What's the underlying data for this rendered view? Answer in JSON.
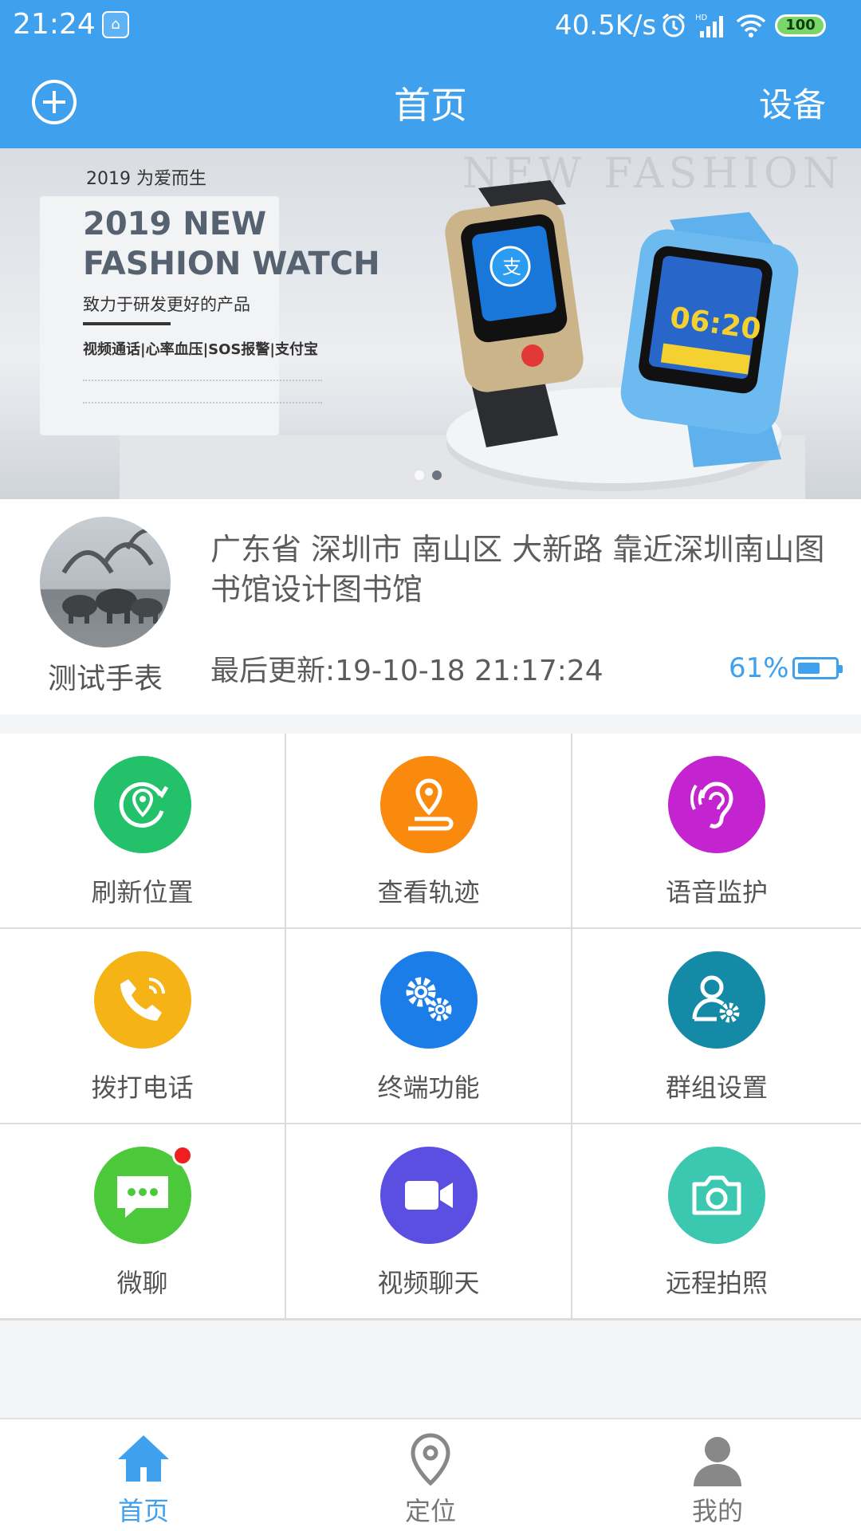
{
  "status_bar": {
    "time": "21:24",
    "net_speed": "40.5K/s",
    "battery_level": "100"
  },
  "header": {
    "title": "首页",
    "right_action": "设备"
  },
  "banner": {
    "year_line": "2019 为爱而生",
    "headline_1": "2019 NEW",
    "headline_2": "FASHION WATCH",
    "subline": "致力于研发更好的产品",
    "features": "视频通话|心率血压|SOS报警|支付宝",
    "bg_text": "NEW FASHION",
    "pages": 2,
    "current_page": 2
  },
  "device": {
    "name": "测试手表",
    "address": "广东省 深圳市 南山区 大新路 靠近深圳南山图书馆设计图书馆",
    "last_update": "最后更新:19-10-18 21:17:24",
    "battery_text": "61%",
    "battery_fraction": 0.61
  },
  "functions": [
    {
      "label": "刷新位置",
      "icon": "refresh-location-icon",
      "color": "#24c16b"
    },
    {
      "label": "查看轨迹",
      "icon": "track-icon",
      "color": "#f98a0d"
    },
    {
      "label": "语音监护",
      "icon": "ear-icon",
      "color": "#c424cf"
    },
    {
      "label": "拨打电话",
      "icon": "phone-call-icon",
      "color": "#f5b315"
    },
    {
      "label": "终端功能",
      "icon": "gears-icon",
      "color": "#1b7ee8"
    },
    {
      "label": "群组设置",
      "icon": "user-settings-icon",
      "color": "#148aa6"
    },
    {
      "label": "微聊",
      "icon": "chat-icon",
      "color": "#4cc93a"
    },
    {
      "label": "视频聊天",
      "icon": "video-camera-icon",
      "color": "#5a4fe0"
    },
    {
      "label": "远程拍照",
      "icon": "camera-icon",
      "color": "#3cc8b0"
    }
  ],
  "bottom_nav": [
    {
      "label": "首页",
      "icon": "home-icon",
      "active": true
    },
    {
      "label": "定位",
      "icon": "location-pin-icon",
      "active": false
    },
    {
      "label": "我的",
      "icon": "user-icon",
      "active": false
    }
  ],
  "colors": {
    "primary": "#3fa0ed",
    "text": "#555555"
  }
}
